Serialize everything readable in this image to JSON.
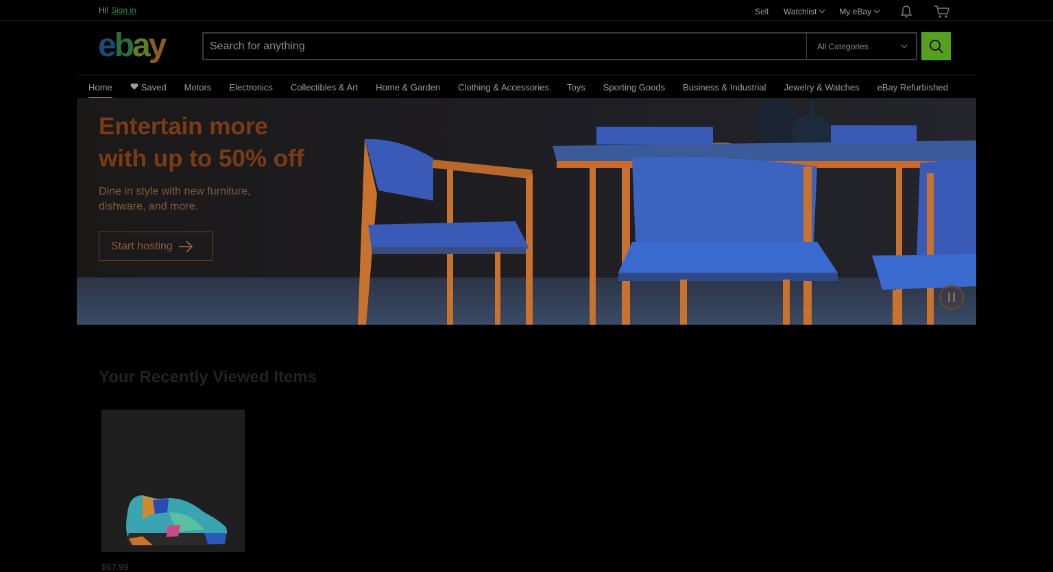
{
  "topbar": {
    "greeting": "Hi!",
    "sign_in": "Sign in",
    "sell": "Sell",
    "watchlist": "Watchlist",
    "my_ebay": "My eBay",
    "icons": [
      "bell-icon",
      "cart-icon"
    ]
  },
  "logo": {
    "letters": [
      "e",
      "b",
      "a",
      "y"
    ]
  },
  "search": {
    "placeholder": "Search for anything",
    "category": "All Categories",
    "button_icon": "search-icon"
  },
  "nav": {
    "home": "Home",
    "saved": "Saved",
    "motors": "Motors",
    "electronics": "Electronics",
    "collectibles": "Collectibles & Art",
    "home_garden": "Home & Garden",
    "clothing": "Clothing & Accessories",
    "toys": "Toys",
    "sporting": "Sporting Goods",
    "business": "Business & Industrial",
    "jewelry": "Jewelry & Watches",
    "refurbished": "eBay Refurbished"
  },
  "hero": {
    "title_line1": "Entertain more",
    "title_line2": "with up to 50% off",
    "subtitle": "Dine in style with new furniture, dishware, and more.",
    "button": "Start hosting"
  },
  "recently_viewed": {
    "title": "Your Recently Viewed Items",
    "items": [
      {
        "price": "$67.99"
      }
    ]
  },
  "colors": {
    "accent_green": "#55a01f",
    "sign_in_link": "#2e8b57",
    "hero_title": "#7a3b16"
  }
}
